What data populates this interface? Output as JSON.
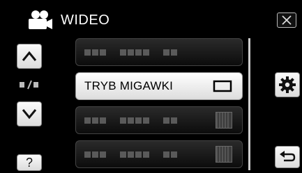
{
  "header": {
    "title": "WIDEO",
    "mode_icon": "video-camera-icon"
  },
  "left": {
    "up_icon": "chevron-up-icon",
    "page_indicator": "■/■",
    "down_icon": "chevron-down-icon",
    "help_label": "?"
  },
  "menu": {
    "items": [
      {
        "label": "",
        "state": "disabled"
      },
      {
        "label": "TRYB MIGAWKI",
        "state": "selected",
        "setting_icon": "wide-frame-icon"
      },
      {
        "label": "",
        "state": "disabled",
        "setting_icon": "dim-setting-icon"
      },
      {
        "label": "",
        "state": "disabled",
        "setting_icon": "dim-setting-icon"
      }
    ]
  },
  "right": {
    "close_icon": "close-icon",
    "settings_icon": "gear-icon",
    "back_icon": "back-arrow-icon"
  },
  "colors": {
    "background": "#000000",
    "selected_item": "#ffffff",
    "disabled_item": "#1a1a1a",
    "text": "#ffffff"
  }
}
